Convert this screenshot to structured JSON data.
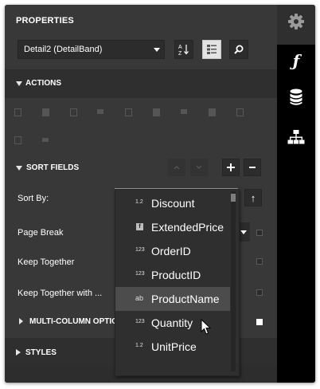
{
  "panel": {
    "title": "PROPERTIES",
    "selector_value": "Detail2 (DetailBand)",
    "sort_button_label": "A↓Z"
  },
  "sections": {
    "actions": "ACTIONS",
    "sort_fields": "SORT FIELDS",
    "multi_column": "MULTI-COLUMN OPTIONS",
    "styles": "STYLES"
  },
  "sort": {
    "label": "Sort By:",
    "value": "",
    "sort_direction_glyph": "↑"
  },
  "rows": {
    "page_break": "Page Break",
    "keep_together": "Keep Together",
    "keep_together_with": "Keep Together with ..."
  },
  "dropdown": {
    "items": [
      {
        "type": "1.2",
        "label": "Discount"
      },
      {
        "type": "f",
        "label": "ExtendedPrice"
      },
      {
        "type": "123",
        "label": "OrderID"
      },
      {
        "type": "123",
        "label": "ProductID"
      },
      {
        "type": "ab",
        "label": "ProductName"
      },
      {
        "type": "123",
        "label": "Quantity"
      },
      {
        "type": "1.2",
        "label": "UnitPrice"
      }
    ],
    "selected_index": 4
  },
  "sidebar": {
    "icons": [
      "gear-icon",
      "function-icon",
      "database-icon",
      "hierarchy-icon"
    ]
  },
  "colors": {
    "panel_bg": "#383838",
    "section_bg": "#2f2f2f",
    "sidebar_bg": "#000000",
    "highlight": "#4c4c4c"
  }
}
